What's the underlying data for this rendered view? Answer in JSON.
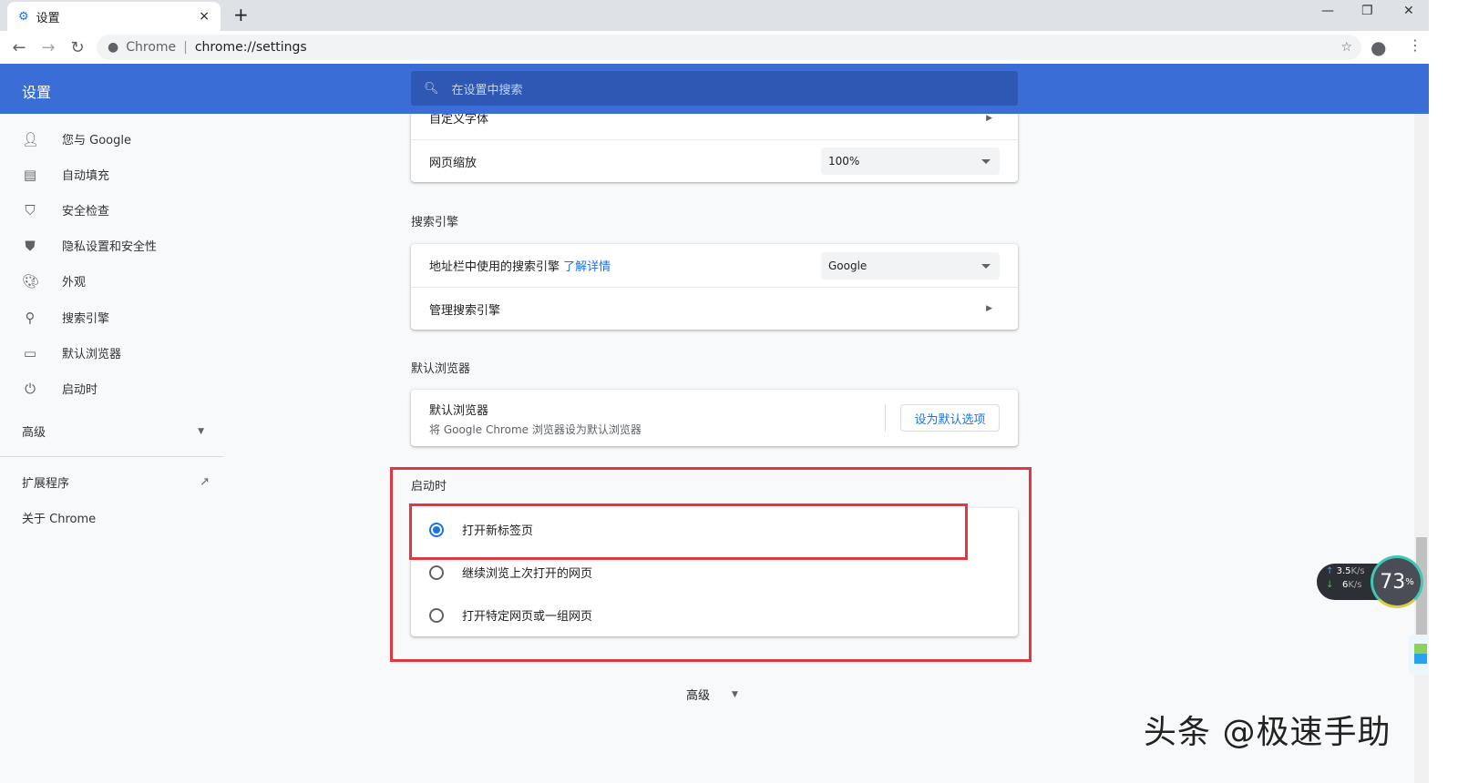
{
  "browser": {
    "tab_title": "设置",
    "new_tab": "+",
    "close": "×",
    "omni_label": "Chrome",
    "url": "chrome://settings",
    "win": {
      "min": "—",
      "restore": "❐",
      "close": "✕"
    }
  },
  "header": {
    "title": "设置",
    "search_placeholder": "在设置中搜索"
  },
  "sidebar": {
    "items": [
      {
        "label": "您与 Google",
        "icon": "person"
      },
      {
        "label": "自动填充",
        "icon": "clipboard"
      },
      {
        "label": "安全检查",
        "icon": "shield-check"
      },
      {
        "label": "隐私设置和安全性",
        "icon": "shield"
      },
      {
        "label": "外观",
        "icon": "palette"
      },
      {
        "label": "搜索引擎",
        "icon": "search"
      },
      {
        "label": "默认浏览器",
        "icon": "browser"
      },
      {
        "label": "启动时",
        "icon": "power"
      }
    ],
    "advanced": "高级",
    "extensions": "扩展程序",
    "about": "关于 Chrome"
  },
  "appearance": {
    "custom_fonts": "自定义字体",
    "zoom_label": "网页缩放",
    "zoom_value": "100%"
  },
  "search_engine": {
    "heading": "搜索引擎",
    "label": "地址栏中使用的搜索引擎",
    "learn_more": "了解详情",
    "value": "Google",
    "manage": "管理搜索引擎"
  },
  "default_browser": {
    "heading": "默认浏览器",
    "title": "默认浏览器",
    "subtitle": "将 Google Chrome 浏览器设为默认浏览器",
    "button": "设为默认选项"
  },
  "startup": {
    "heading": "启动时",
    "options": [
      {
        "label": "打开新标签页",
        "selected": true
      },
      {
        "label": "继续浏览上次打开的网页",
        "selected": false
      },
      {
        "label": "打开特定网页或一组网页",
        "selected": false
      }
    ]
  },
  "advanced_footer": "高级",
  "widget": {
    "up": "3.5",
    "down": "6",
    "unit": "K/s",
    "percent": "73",
    "pct": "%"
  },
  "watermark": "头条 @极速手助"
}
